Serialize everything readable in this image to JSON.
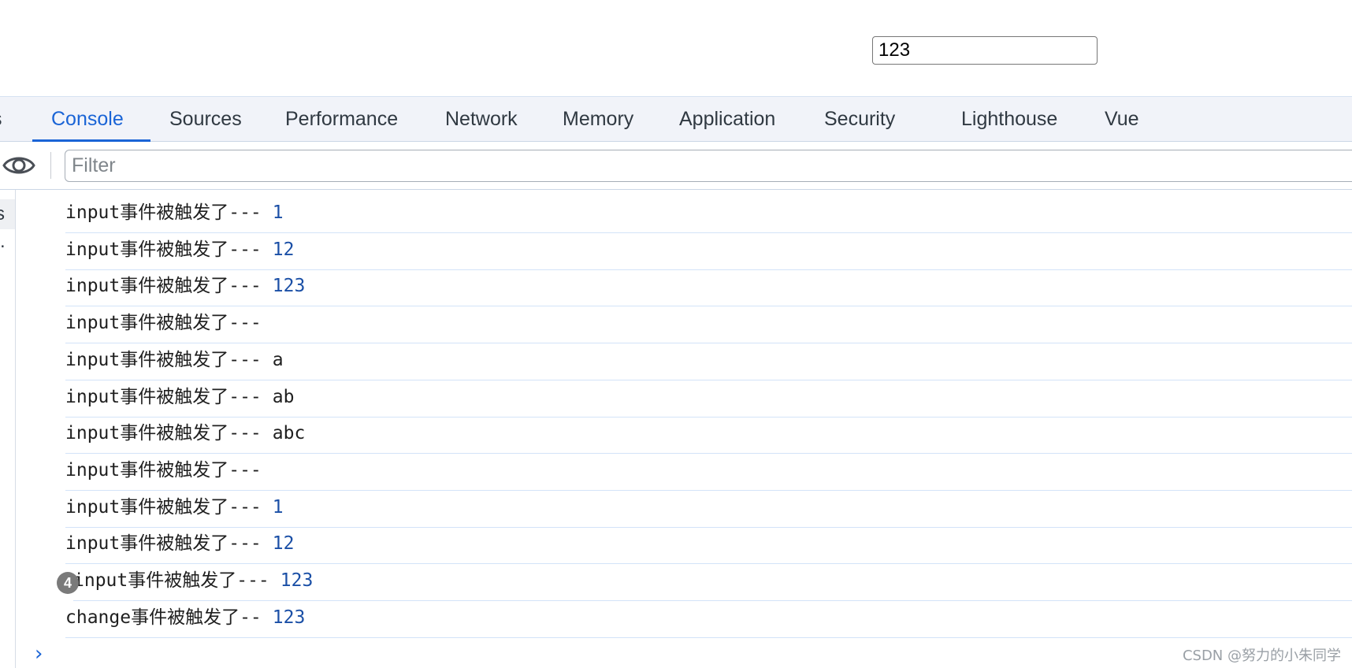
{
  "page": {
    "input_value": "123"
  },
  "devtools": {
    "tabs": [
      {
        "label": "s"
      },
      {
        "label": "Console"
      },
      {
        "label": "Sources"
      },
      {
        "label": "Performance"
      },
      {
        "label": "Network"
      },
      {
        "label": "Memory"
      },
      {
        "label": "Application"
      },
      {
        "label": "Security"
      },
      {
        "label": "Lighthouse"
      },
      {
        "label": "Vue"
      }
    ],
    "active_tab": "Console",
    "filter_placeholder": "Filter",
    "sidebar": {
      "item_label": "s",
      "dot": "."
    },
    "logs": [
      {
        "text": "input事件被触发了---",
        "value": "1",
        "kind": "number"
      },
      {
        "text": "input事件被触发了---",
        "value": "12",
        "kind": "number"
      },
      {
        "text": "input事件被触发了---",
        "value": "123",
        "kind": "number"
      },
      {
        "text": "input事件被触发了---",
        "value": "",
        "kind": "string"
      },
      {
        "text": "input事件被触发了---",
        "value": "a",
        "kind": "string"
      },
      {
        "text": "input事件被触发了---",
        "value": "ab",
        "kind": "string"
      },
      {
        "text": "input事件被触发了---",
        "value": "abc",
        "kind": "string"
      },
      {
        "text": "input事件被触发了---",
        "value": "",
        "kind": "string"
      },
      {
        "text": "input事件被触发了---",
        "value": "1",
        "kind": "number"
      },
      {
        "text": "input事件被触发了---",
        "value": "12",
        "kind": "number"
      },
      {
        "text": "input事件被触发了---",
        "value": "123",
        "kind": "number",
        "repeat": "4"
      },
      {
        "text": "change事件被触发了--",
        "value": "123",
        "kind": "number"
      }
    ],
    "prompt_symbol": "›"
  },
  "watermark": "CSDN @努力的小朱同学",
  "colors": {
    "accent": "#1a64d6",
    "number_value": "#1a4fa6",
    "row_divider": "#d3e3f8"
  }
}
